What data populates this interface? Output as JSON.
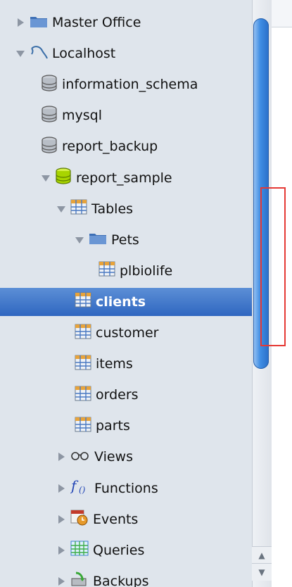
{
  "tree": [
    {
      "label": "Master Office",
      "icon": "folder-icon",
      "expander": "closed",
      "indent": 22
    },
    {
      "label": "Localhost",
      "icon": "mysql-dolphin-icon",
      "expander": "open",
      "indent": 22
    },
    {
      "label": "information_schema",
      "icon": "database-icon",
      "expander": "none",
      "indent": 58
    },
    {
      "label": "mysql",
      "icon": "database-icon",
      "expander": "none",
      "indent": 58
    },
    {
      "label": "report_backup",
      "icon": "database-icon",
      "expander": "none",
      "indent": 58
    },
    {
      "label": "report_sample",
      "icon": "database-open-icon",
      "expander": "open",
      "indent": 58
    },
    {
      "label": "Tables",
      "icon": "table-icon",
      "expander": "open",
      "indent": 80
    },
    {
      "label": "Pets",
      "icon": "folder-icon",
      "expander": "open",
      "indent": 106
    },
    {
      "label": "plbiolife",
      "icon": "table-icon",
      "expander": "none",
      "indent": 140
    },
    {
      "label": "clients",
      "icon": "table-icon",
      "expander": "none",
      "indent": 106,
      "selected": true
    },
    {
      "label": "customer",
      "icon": "table-icon",
      "expander": "none",
      "indent": 106
    },
    {
      "label": "items",
      "icon": "table-icon",
      "expander": "none",
      "indent": 106
    },
    {
      "label": "orders",
      "icon": "table-icon",
      "expander": "none",
      "indent": 106
    },
    {
      "label": "parts",
      "icon": "table-icon",
      "expander": "none",
      "indent": 106
    },
    {
      "label": "Views",
      "icon": "glasses-icon",
      "expander": "closed",
      "indent": 80
    },
    {
      "label": "Functions",
      "icon": "function-icon",
      "expander": "closed",
      "indent": 80
    },
    {
      "label": "Events",
      "icon": "events-icon",
      "expander": "closed",
      "indent": 80
    },
    {
      "label": "Queries",
      "icon": "queries-icon",
      "expander": "closed",
      "indent": 80
    },
    {
      "label": "Backups",
      "icon": "backups-icon",
      "expander": "closed",
      "indent": 80
    }
  ],
  "scrollbar": {
    "up_arrow": "▲",
    "down_arrow": "▼"
  }
}
